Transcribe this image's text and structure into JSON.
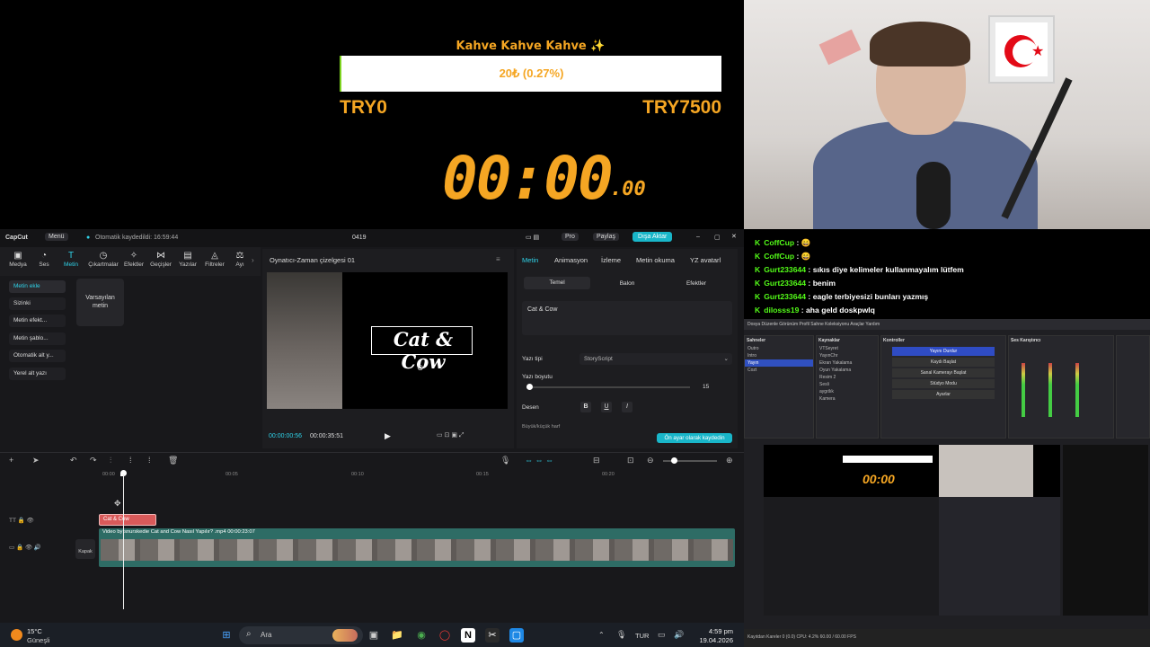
{
  "overlay": {
    "goal_title": "Kahve Kahve Kahve ✨",
    "goal_progress": "20₺ (0.27%)",
    "goal_fraction": 0.0027,
    "goal_min": "TRY0",
    "goal_max": "TRY7500",
    "timer_main": "00:00",
    "timer_ms": ".00"
  },
  "chat": [
    {
      "user": "CoffCup",
      "msg": "😄"
    },
    {
      "user": "CoffCup",
      "msg": "😄"
    },
    {
      "user": "Gurt233644",
      "msg": "sıkıs diye kelimeler kullanmayalım lütfem"
    },
    {
      "user": "Gurt233644",
      "msg": "benim"
    },
    {
      "user": "Gurt233644",
      "msg": "eagle terbiyesizi bunları yazmış"
    },
    {
      "user": "dilosss19",
      "msg": "aha geld doskpwlq"
    }
  ],
  "capcut": {
    "app_name": "CapCut",
    "menu": "Menü",
    "autosave": "Otomatik kaydedildi: 16:59:44",
    "project": "0419",
    "pro": "Pro",
    "share": "Paylaş",
    "export": "Dışa Aktar",
    "tools": [
      {
        "label": "Medya",
        "icon": "▣"
      },
      {
        "label": "Ses",
        "icon": "◔"
      },
      {
        "label": "Metin",
        "icon": "T"
      },
      {
        "label": "Çıkartmalar",
        "icon": "◷"
      },
      {
        "label": "Efektler",
        "icon": "✧"
      },
      {
        "label": "Geçişler",
        "icon": "⋈"
      },
      {
        "label": "Yazılar",
        "icon": "▤"
      },
      {
        "label": "Filtreler",
        "icon": "◬"
      },
      {
        "label": "Ayı",
        "icon": "⚖"
      }
    ],
    "side_items": [
      "Metin ekle",
      "Sizinki",
      "Metin efekt...",
      "Metin şablo...",
      "Otomatik alt y...",
      "Yerel alt yazı"
    ],
    "preset": "Varsayılan metin",
    "player_title": "Oynatıcı-Zaman çizelgesi 01",
    "canvas_text": "Cat & Cow",
    "time_current": "00:00:00:56",
    "time_total": "00:00:35:51",
    "prop_tabs": [
      "Metin",
      "Animasyon",
      "İzleme",
      "Metin okuma",
      "YZ avatarl"
    ],
    "sub_tabs": [
      "Temel",
      "Balon",
      "Efektler"
    ],
    "text_value": "Cat & Cow",
    "font_label": "Yazı tipi",
    "font_value": "StoryScript",
    "size_label": "Yazı boyutu",
    "size_value": "15",
    "pattern_label": "Desen",
    "case_label": "Büyük/küçük harf",
    "default_btn": "Ön ayar olarak kaydedin",
    "ruler": [
      "00:00",
      "00:05",
      "00:10",
      "00:15",
      "00:20"
    ],
    "text_clip": "Cat & Cow",
    "video_clip": "Video by snurskedie   Cat and Cow Nasıl Yapılır? .mp4   00:00:23:07",
    "cover": "Kapak"
  },
  "obs": {
    "menu": "Dosya  Düzenle  Görünüm  Profil  Sahne Koleksiyonu  Araçlar  Yardım",
    "scenes_title": "Sahneler",
    "scenes": [
      "Outro",
      "Intro",
      "Yayın",
      "Cozt"
    ],
    "sources_title": "Kaynaklar",
    "sources": [
      "VTSeyret",
      "YayınChr",
      "Ekran Yakalama",
      "Oyun Yakalama",
      "Resim 2",
      "Sesli",
      "aygıtlık",
      "Kamera"
    ],
    "controls_title": "Kontroller",
    "controls": [
      "Yayını Durdur",
      "Kaydı Başlat",
      "Sanal Kamerayı Başlat",
      "Stüdyo Modu",
      "Ayarlar"
    ],
    "mixer_title": "Ses Karıştırıcı",
    "status": "Kayıtdan Kareler 0 (0.0)   CPU: 4.2%   60.00 / 60.00 FPS"
  },
  "taskbar": {
    "temp": "15°C",
    "weather": "Güneşli",
    "search": "Ara",
    "lang": "TUR",
    "time": "4:59 pm",
    "date": "19.04.2026"
  },
  "colors": {
    "overlay_accent": "#f5a623",
    "chat_user": "#53fc18",
    "capcut_accent": "#2fd2e8",
    "text_clip": "#d95a5a",
    "video_clip": "#2e6c65"
  }
}
